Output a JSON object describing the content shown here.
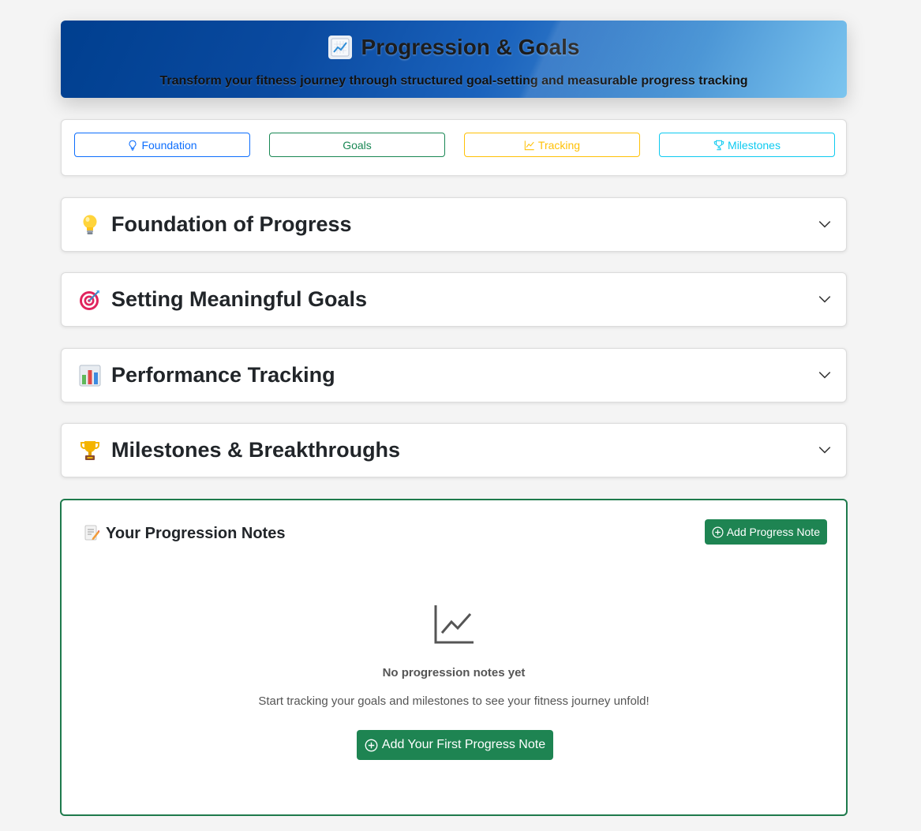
{
  "hero": {
    "icon": "chart-increasing-icon",
    "title": "Progression & Goals",
    "subtitle": "Transform your fitness journey through structured goal-setting and measurable progress tracking"
  },
  "nav": {
    "buttons": [
      {
        "label": "Foundation",
        "icon": "lightbulb-icon",
        "color": "#0d6efd"
      },
      {
        "label": "Goals",
        "icon": "",
        "color": "#198754"
      },
      {
        "label": "Tracking",
        "icon": "graph-up-icon",
        "color": "#ffc107"
      },
      {
        "label": "Milestones",
        "icon": "trophy-icon",
        "color": "#0dcaf0"
      }
    ]
  },
  "sections": [
    {
      "icon": "light-bulb-icon",
      "title": "Foundation of Progress"
    },
    {
      "icon": "direct-hit-icon",
      "title": "Setting Meaningful Goals"
    },
    {
      "icon": "bar-chart-icon",
      "title": "Performance Tracking"
    },
    {
      "icon": "trophy-icon",
      "title": "Milestones & Breakthroughs"
    }
  ],
  "notes": {
    "icon": "memo-icon",
    "title": "Your Progression Notes",
    "add_label": "Add Progress Note",
    "empty_icon": "graph-up-icon",
    "empty_title": "No progression notes yet",
    "empty_subtitle": "Start tracking your goals and milestones to see your fitness journey unfold!",
    "first_label": "Add Your First Progress Note"
  },
  "colors": {
    "primary_green": "#1e8452",
    "hero_start": "#003f8f",
    "hero_end": "#7cc5ef"
  }
}
